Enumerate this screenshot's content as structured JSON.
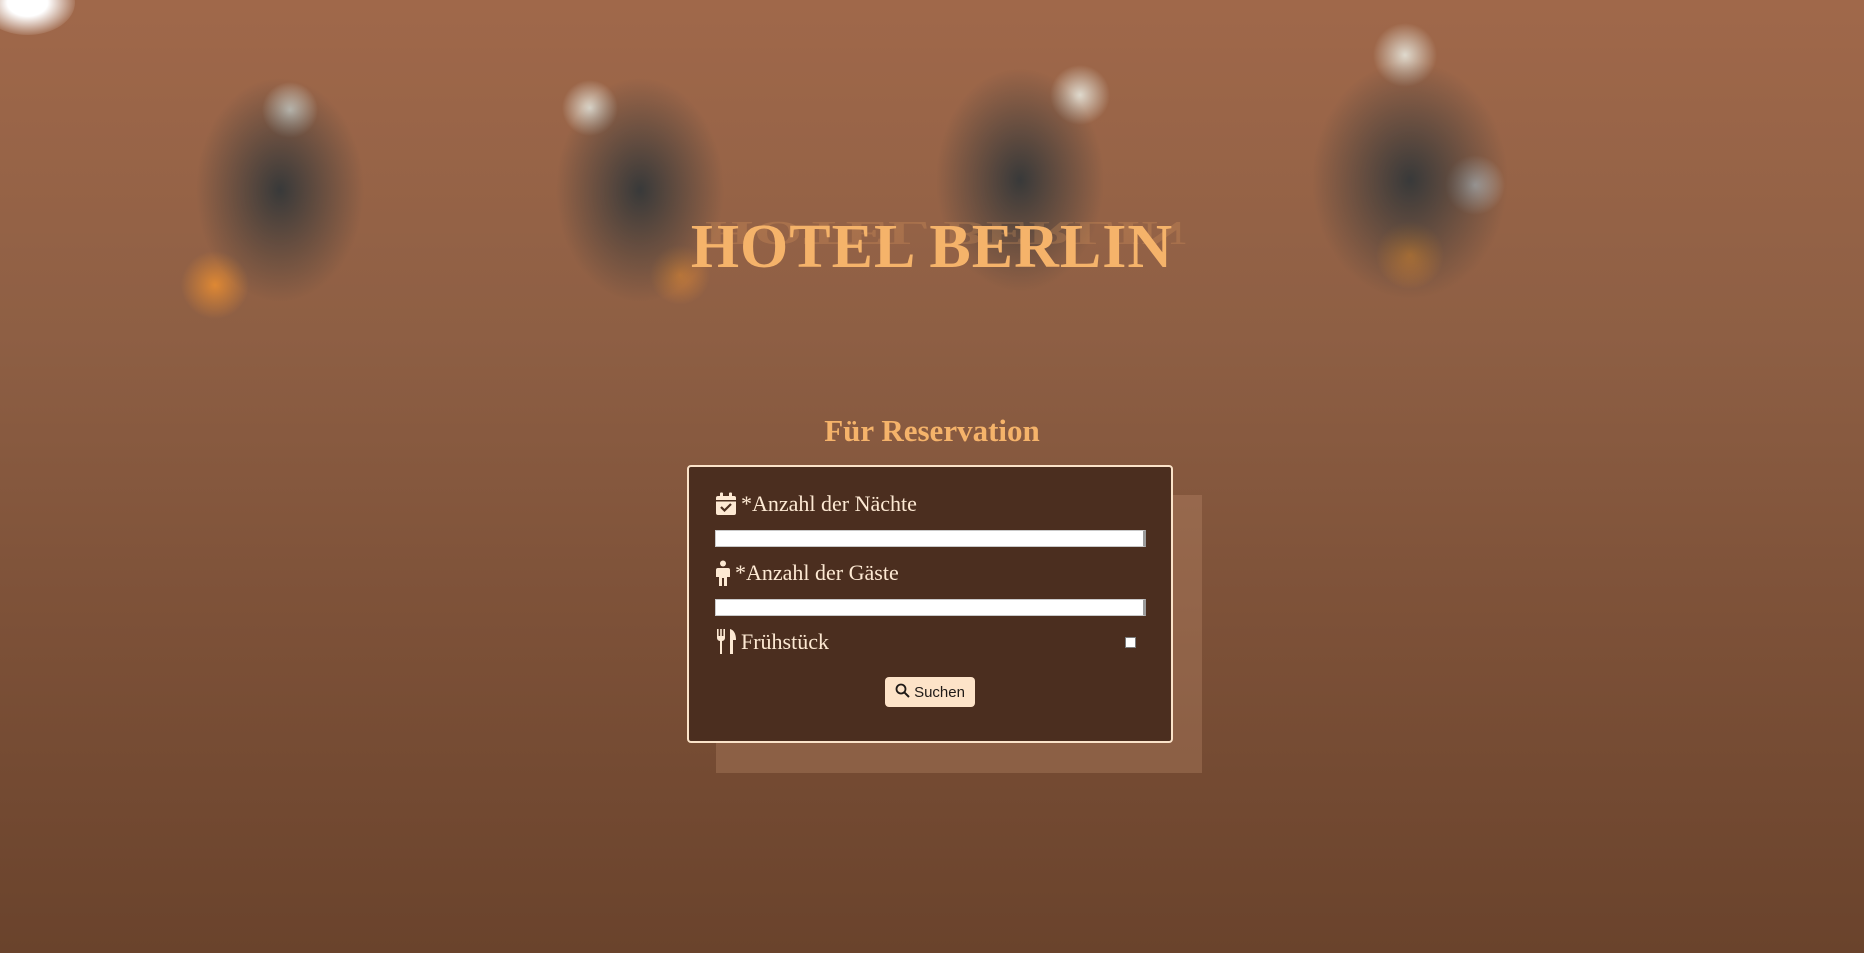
{
  "header": {
    "title": "HOTEL BERLIN",
    "subtitle": "Für Reservation"
  },
  "form": {
    "nights": {
      "label": "*Anzahl der Nächte",
      "icon": "calendar-check-icon",
      "value": ""
    },
    "guests": {
      "label": "*Anzahl der Gäste",
      "icon": "person-icon",
      "value": ""
    },
    "breakfast": {
      "label": "Frühstück",
      "icon": "fork-knife-icon",
      "checked": false
    },
    "search_button": {
      "label": "Suchen",
      "icon": "search-icon"
    }
  },
  "colors": {
    "title": "#f5b36a",
    "form_background": "#4b2e1f",
    "form_border": "#fbe3c9",
    "label_text": "#fde9d3",
    "button_background": "#fde3c8"
  }
}
